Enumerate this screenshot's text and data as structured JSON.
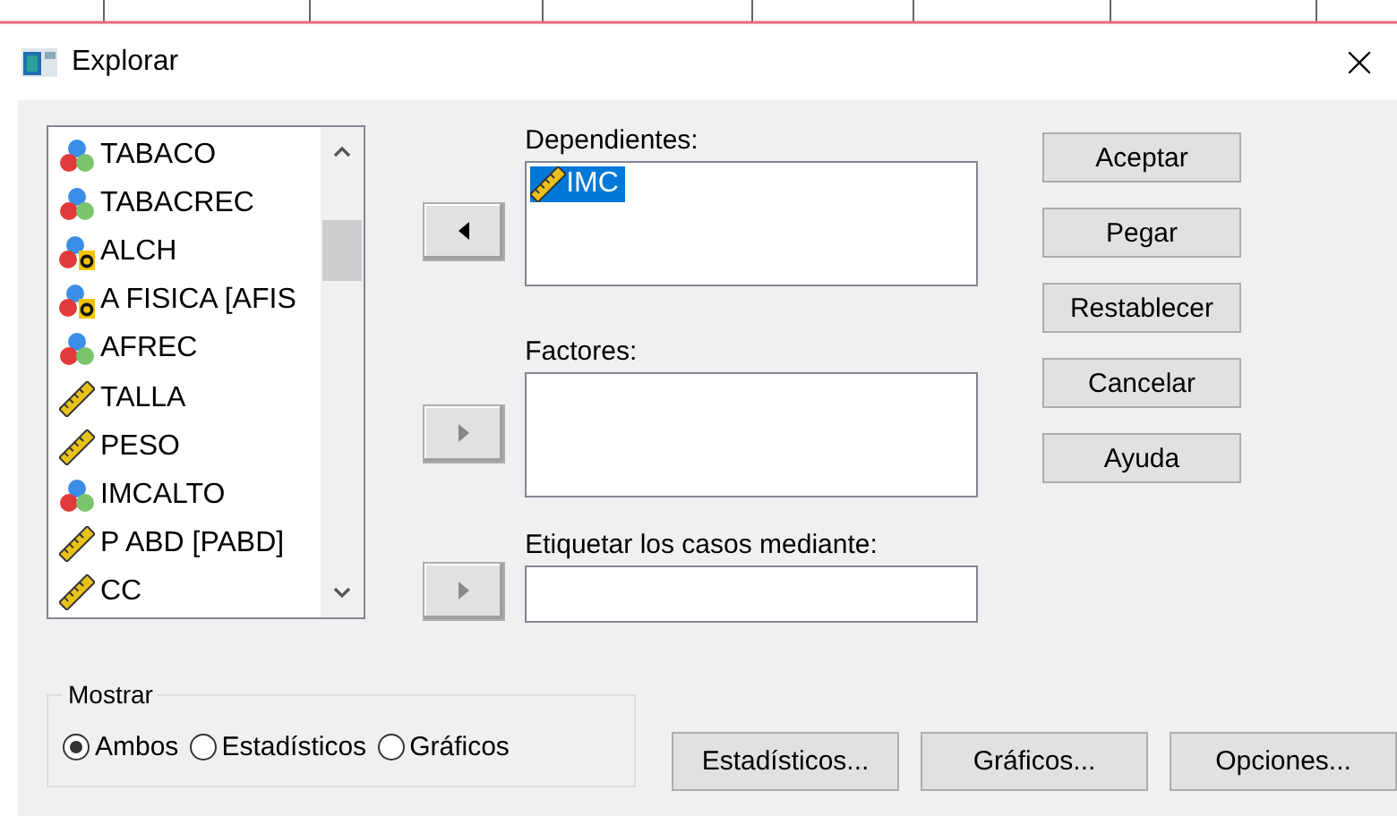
{
  "window": {
    "title": "Explorar"
  },
  "variables": [
    {
      "name": "TABACO",
      "kind": "nominal"
    },
    {
      "name": "TABACREC",
      "kind": "nominal"
    },
    {
      "name": "ALCH",
      "kind": "string"
    },
    {
      "name": "A FISICA [AFIS",
      "kind": "string"
    },
    {
      "name": "AFREC",
      "kind": "nominal"
    },
    {
      "name": "TALLA",
      "kind": "scale"
    },
    {
      "name": "PESO",
      "kind": "scale"
    },
    {
      "name": "IMCALTO",
      "kind": "nominal"
    },
    {
      "name": "P ABD [PABD]",
      "kind": "scale"
    },
    {
      "name": "CC",
      "kind": "scale"
    }
  ],
  "targets": [
    {
      "label": "Dependientes:",
      "kind": "list",
      "move_button": {
        "kind": "left",
        "disabled": false
      },
      "items": [
        {
          "name": "IMC",
          "kind": "scale",
          "selected": true
        }
      ]
    },
    {
      "label": "Factores:",
      "kind": "list",
      "move_button": {
        "kind": "right",
        "disabled": true
      }
    },
    {
      "label": "Etiquetar los casos mediante:",
      "kind": "field",
      "move_button": {
        "kind": "right",
        "disabled": true
      }
    }
  ],
  "side_buttons": [
    "Aceptar",
    "Pegar",
    "Restablecer",
    "Cancelar",
    "Ayuda"
  ],
  "display": {
    "title": "Mostrar",
    "options": [
      {
        "label": "Ambos",
        "selected": true
      },
      {
        "label": "Estadísticos",
        "selected": false
      },
      {
        "label": "Gráficos",
        "selected": false
      }
    ]
  },
  "bottom_buttons": [
    "Estadísticos...",
    "Gráficos...",
    "Opciones..."
  ]
}
